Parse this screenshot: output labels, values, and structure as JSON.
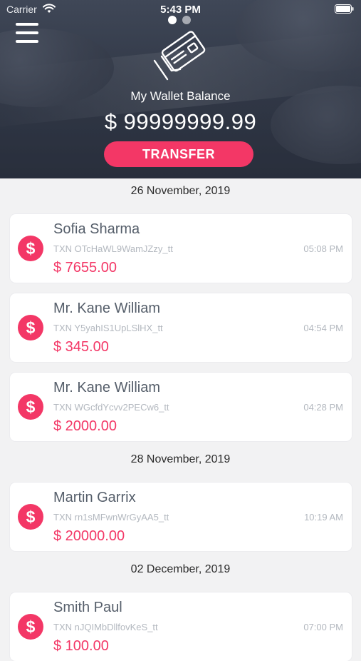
{
  "status_bar": {
    "carrier": "Carrier",
    "time": "5:43 PM"
  },
  "colors": {
    "accent": "#f33766",
    "header_bg": "#3d4453",
    "page_bg": "#f2f2f3"
  },
  "header": {
    "page_dots": {
      "count": 2,
      "active": 0
    },
    "menu_icon": "hamburger-menu-icon",
    "wallet_icon": "credit-card-hand-icon",
    "balance_label": "My Wallet Balance",
    "balance_amount": "$ 99999999.99",
    "transfer_label": "TRANSFER"
  },
  "groups": [
    {
      "date": "26 November, 2019",
      "transactions": [
        {
          "name": "Sofia Sharma",
          "txn_id": "TXN OTcHaWL9WamJZzy_tt",
          "amount": "$ 7655.00",
          "time": "05:08 PM",
          "icon": "dollar-icon",
          "icon_glyph": "$"
        },
        {
          "name": "Mr. Kane William",
          "txn_id": "TXN Y5yahIS1UpLSlHX_tt",
          "amount": "$ 345.00",
          "time": "04:54 PM",
          "icon": "dollar-icon",
          "icon_glyph": "$"
        },
        {
          "name": "Mr. Kane William",
          "txn_id": "TXN WGcfdYcvv2PECw6_tt",
          "amount": "$ 2000.00",
          "time": "04:28 PM",
          "icon": "dollar-icon",
          "icon_glyph": "$"
        }
      ]
    },
    {
      "date": "28 November, 2019",
      "transactions": [
        {
          "name": "Martin Garrix",
          "txn_id": "TXN rn1sMFwnWrGyAA5_tt",
          "amount": "$ 20000.00",
          "time": "10:19 AM",
          "icon": "dollar-icon",
          "icon_glyph": "$"
        }
      ]
    },
    {
      "date": "02 December, 2019",
      "transactions": [
        {
          "name": "Smith Paul",
          "txn_id": "TXN nJQIMbDllfovKeS_tt",
          "amount": "$ 100.00",
          "time": "07:00 PM",
          "icon": "dollar-icon",
          "icon_glyph": "$"
        }
      ]
    }
  ]
}
